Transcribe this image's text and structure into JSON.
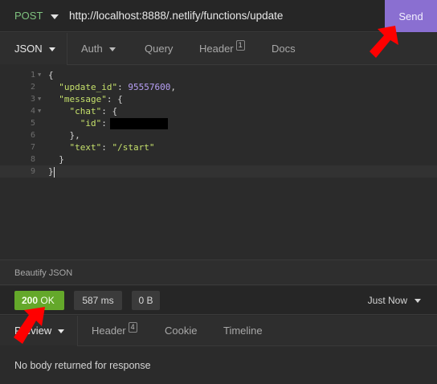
{
  "request": {
    "method": "POST",
    "url": "http://localhost:8888/.netlify/functions/update",
    "send_label": "Send"
  },
  "request_tabs": [
    {
      "label": "JSON",
      "active": true
    },
    {
      "label": "Auth"
    },
    {
      "label": "Query"
    },
    {
      "label": "Header",
      "count": "1"
    },
    {
      "label": "Docs"
    }
  ],
  "editor": {
    "line_numbers": [
      "1",
      "2",
      "3",
      "4",
      "5",
      "6",
      "7",
      "8",
      "9"
    ],
    "lines": [
      {
        "indent": "",
        "parts": [
          {
            "t": "p",
            "v": "{"
          }
        ]
      },
      {
        "indent": "  ",
        "parts": [
          {
            "t": "k",
            "v": "\"update_id\""
          },
          {
            "t": "p",
            "v": ": "
          },
          {
            "t": "n",
            "v": "95557600"
          },
          {
            "t": "p",
            "v": ","
          }
        ]
      },
      {
        "indent": "  ",
        "parts": [
          {
            "t": "k",
            "v": "\"message\""
          },
          {
            "t": "p",
            "v": ": {"
          }
        ]
      },
      {
        "indent": "    ",
        "parts": [
          {
            "t": "k",
            "v": "\"chat\""
          },
          {
            "t": "p",
            "v": ": {"
          }
        ]
      },
      {
        "indent": "      ",
        "parts": [
          {
            "t": "k",
            "v": "\"id\""
          },
          {
            "t": "p",
            "v": ":"
          }
        ],
        "redacted": true
      },
      {
        "indent": "    ",
        "parts": [
          {
            "t": "p",
            "v": "},"
          }
        ]
      },
      {
        "indent": "    ",
        "parts": [
          {
            "t": "k",
            "v": "\"text\""
          },
          {
            "t": "p",
            "v": ": "
          },
          {
            "t": "s",
            "v": "\"/start\""
          }
        ]
      },
      {
        "indent": "  ",
        "parts": [
          {
            "t": "p",
            "v": "}"
          }
        ]
      },
      {
        "indent": "",
        "parts": [
          {
            "t": "p",
            "v": "}"
          }
        ],
        "cursor": true
      }
    ]
  },
  "beautify_label": "Beautify JSON",
  "response": {
    "status_code": "200",
    "status_text": "OK",
    "time": "587 ms",
    "size": "0 B",
    "history_label": "Just Now",
    "tabs": [
      {
        "label": "Preview",
        "active": true
      },
      {
        "label": "Header",
        "count": "4"
      },
      {
        "label": "Cookie"
      },
      {
        "label": "Timeline"
      }
    ],
    "body_message": "No body returned for response"
  },
  "colors": {
    "send_button": "#8a6fd1",
    "status_ok": "#64a82a",
    "annotation_arrow": "#ff0000"
  }
}
